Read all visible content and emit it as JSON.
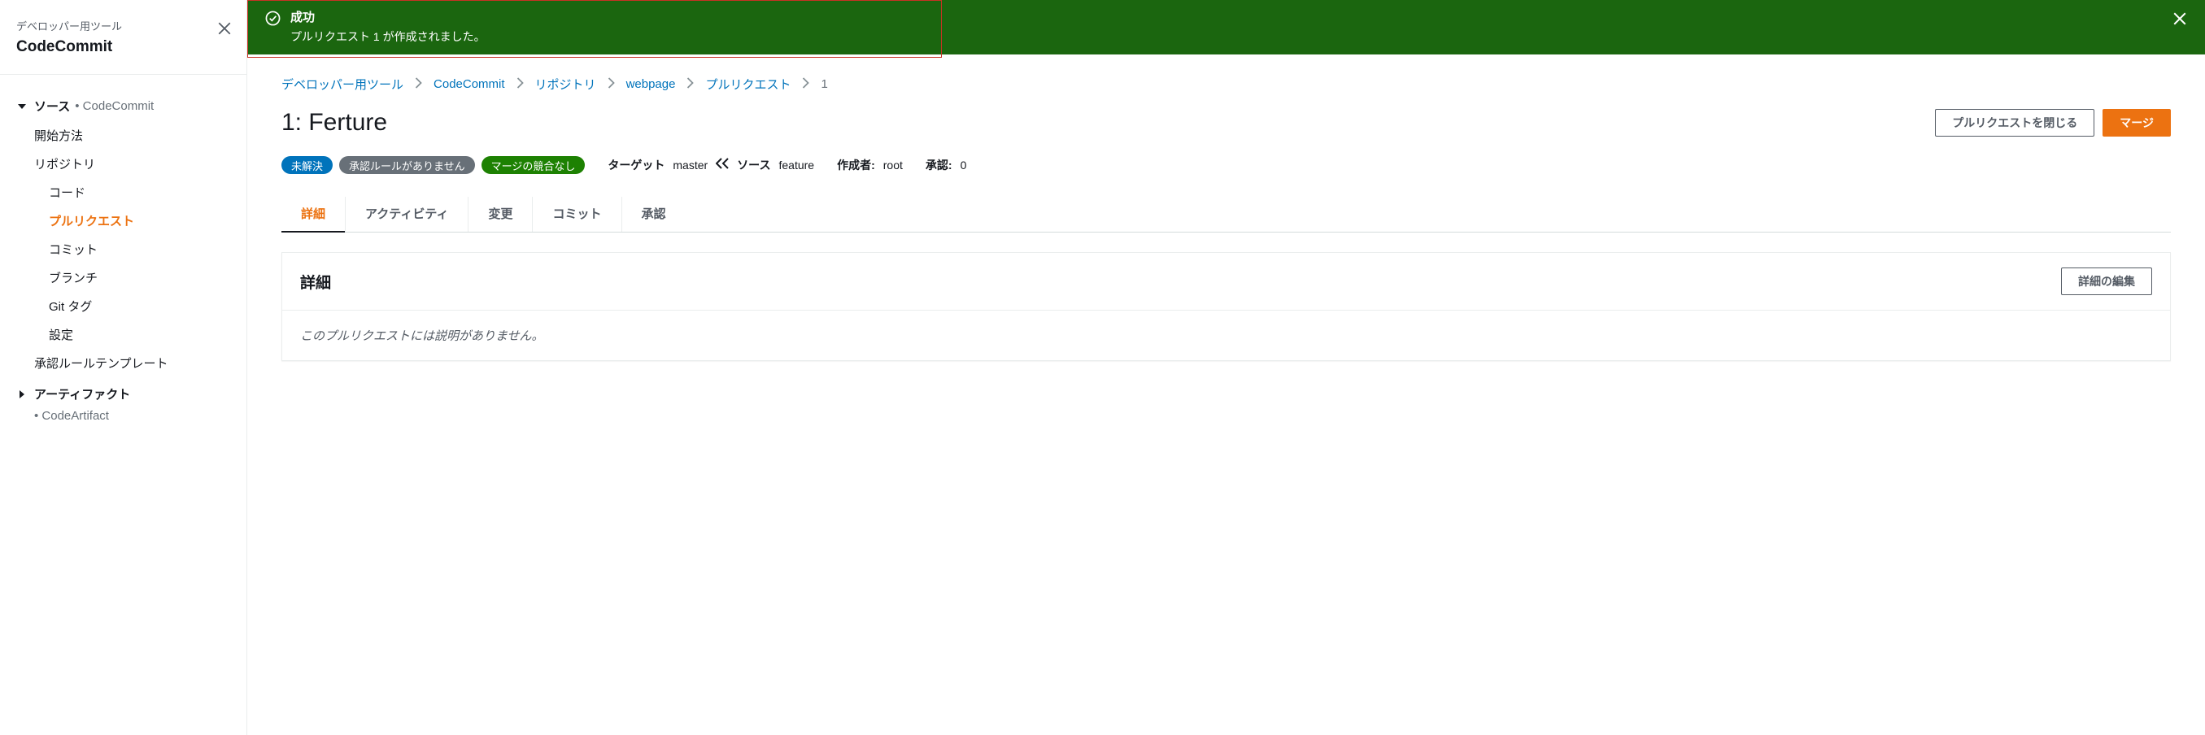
{
  "sidebar": {
    "header_sub": "デベロッパー用ツール",
    "header_title": "CodeCommit",
    "sections": [
      {
        "title": "ソース",
        "sub": "• CodeCommit",
        "expanded": true,
        "items": [
          {
            "label": "開始方法",
            "lvl": 1
          },
          {
            "label": "リポジトリ",
            "lvl": 1
          },
          {
            "label": "コード",
            "lvl": 2
          },
          {
            "label": "プルリクエスト",
            "lvl": 2,
            "active": true
          },
          {
            "label": "コミット",
            "lvl": 2
          },
          {
            "label": "ブランチ",
            "lvl": 2
          },
          {
            "label": "Git タグ",
            "lvl": 2
          },
          {
            "label": "設定",
            "lvl": 2
          },
          {
            "label": "承認ルールテンプレート",
            "lvl": 1
          }
        ]
      },
      {
        "title": "アーティファクト",
        "sub": "• CodeArtifact",
        "expanded": false,
        "items": []
      }
    ]
  },
  "alert": {
    "title": "成功",
    "message": "プルリクエスト 1 が作成されました。"
  },
  "breadcrumbs": {
    "items": [
      {
        "label": "デベロッパー用ツール"
      },
      {
        "label": "CodeCommit"
      },
      {
        "label": "リポジトリ"
      },
      {
        "label": "webpage"
      },
      {
        "label": "プルリクエスト"
      }
    ],
    "current": "1"
  },
  "page": {
    "title": "1: Ferture",
    "btn_close": "プルリクエストを閉じる",
    "btn_merge": "マージ"
  },
  "status": {
    "badge_unresolved": "未解決",
    "badge_no_rules": "承認ルールがありません",
    "badge_no_conflict": "マージの競合なし",
    "target_label": "ターゲット",
    "target_val": "master",
    "source_label": "ソース",
    "source_val": "feature",
    "author_label": "作成者:",
    "author_val": "root",
    "approval_label": "承認:",
    "approval_val": "0"
  },
  "tabs": {
    "items": [
      {
        "label": "詳細",
        "active": true
      },
      {
        "label": "アクティビティ"
      },
      {
        "label": "変更"
      },
      {
        "label": "コミット"
      },
      {
        "label": "承認"
      }
    ]
  },
  "panel": {
    "title": "詳細",
    "btn_edit": "詳細の編集",
    "body": "このプルリクエストには説明がありません。"
  }
}
